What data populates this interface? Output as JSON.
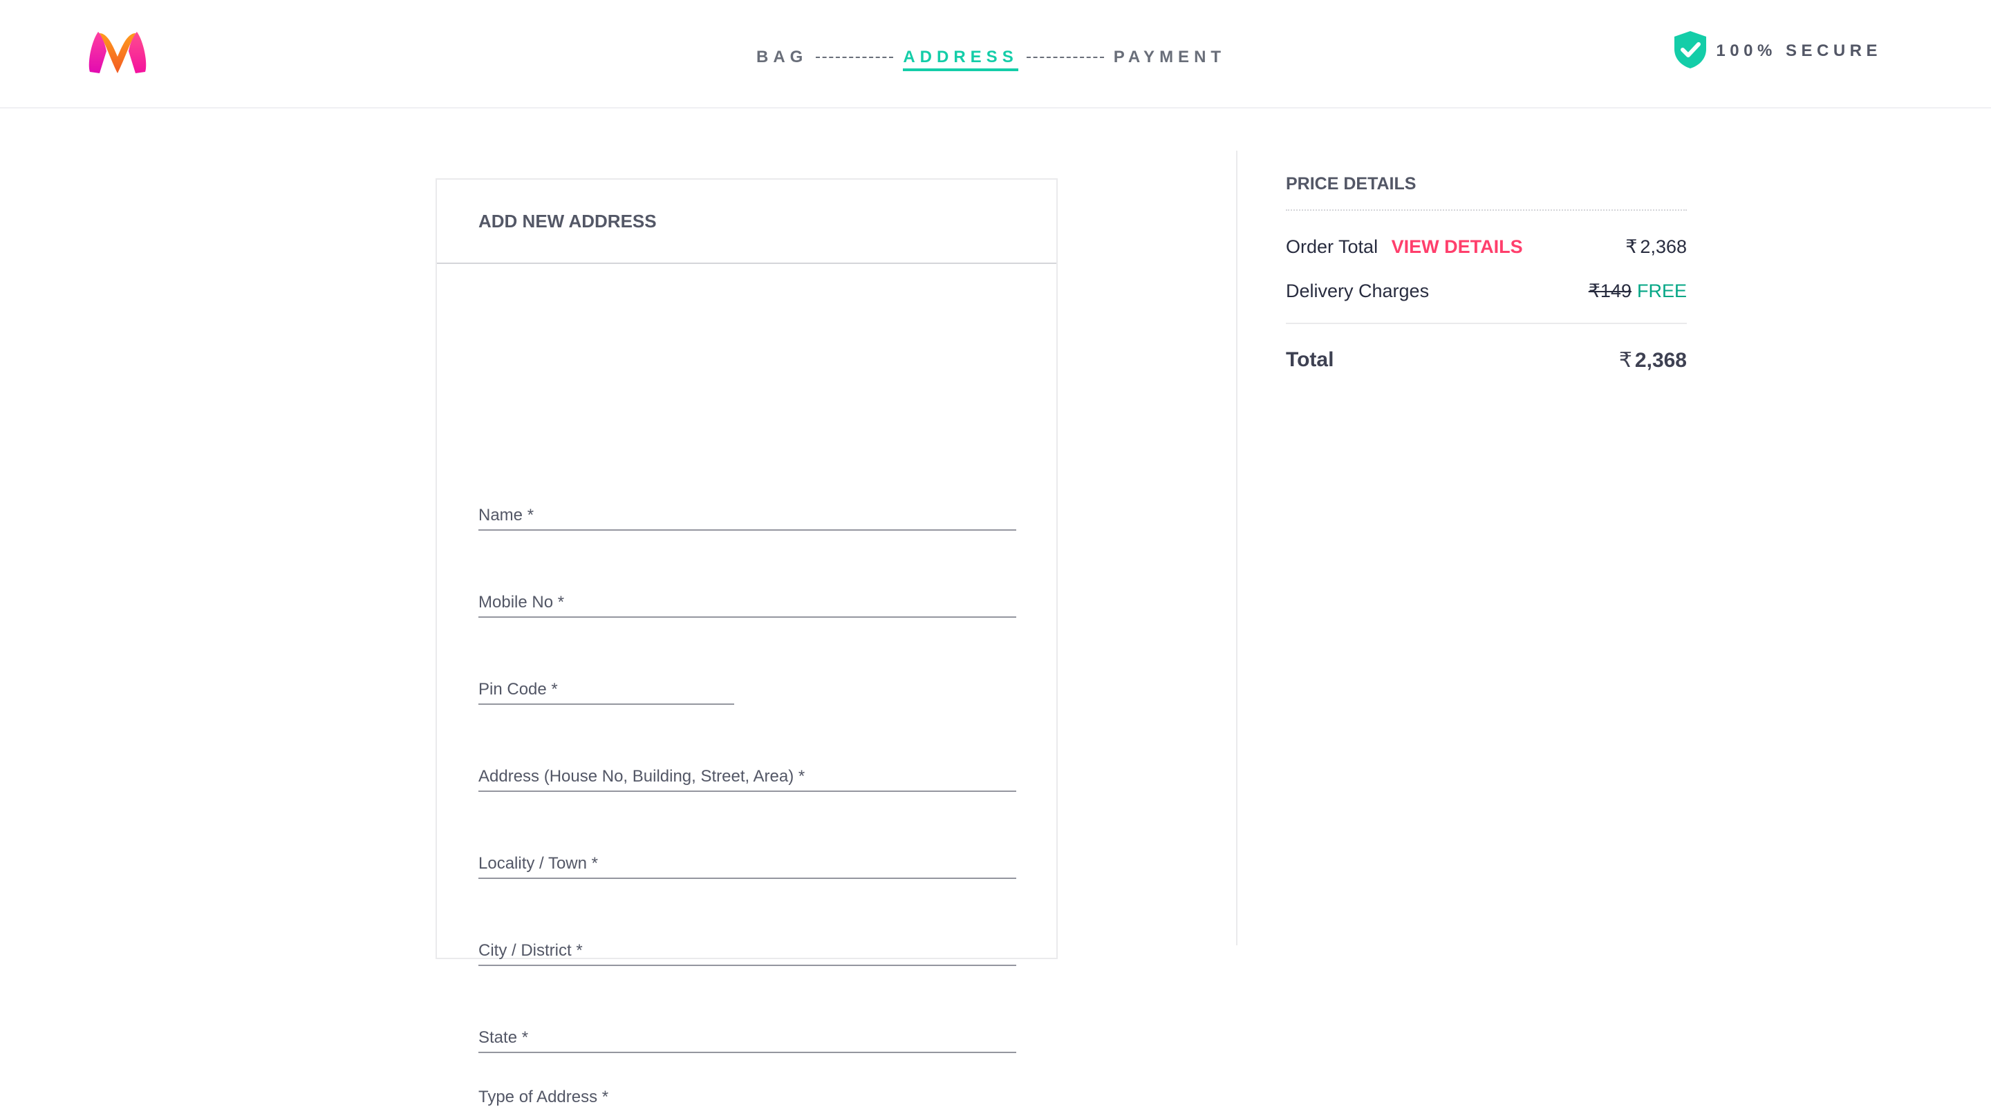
{
  "header": {
    "steps": [
      {
        "label": "BAG",
        "active": false
      },
      {
        "label": "ADDRESS",
        "active": true
      },
      {
        "label": "PAYMENT",
        "active": false
      }
    ],
    "secure_label": "100% SECURE"
  },
  "form": {
    "title": "ADD NEW ADDRESS",
    "fields": {
      "name": "Name *",
      "mobile": "Mobile No *",
      "pincode": "Pin Code *",
      "address": "Address (House No, Building, Street, Area) *",
      "locality": "Locality / Town *",
      "city": "City / District *",
      "state": "State *"
    },
    "type_label": "Type of Address *"
  },
  "price_details": {
    "title": "PRICE DETAILS",
    "order_total_label": "Order Total",
    "view_details_label": "VIEW DETAILS",
    "order_total_value": "2,368",
    "delivery_label": "Delivery Charges",
    "delivery_original": "149",
    "delivery_value": "FREE",
    "total_label": "Total",
    "total_value": "2,368",
    "currency_symbol": "₹"
  },
  "colors": {
    "accent": "#14cda8",
    "brand_pink": "#ff3f6c",
    "free_green": "#03a685",
    "text": "#535766"
  }
}
